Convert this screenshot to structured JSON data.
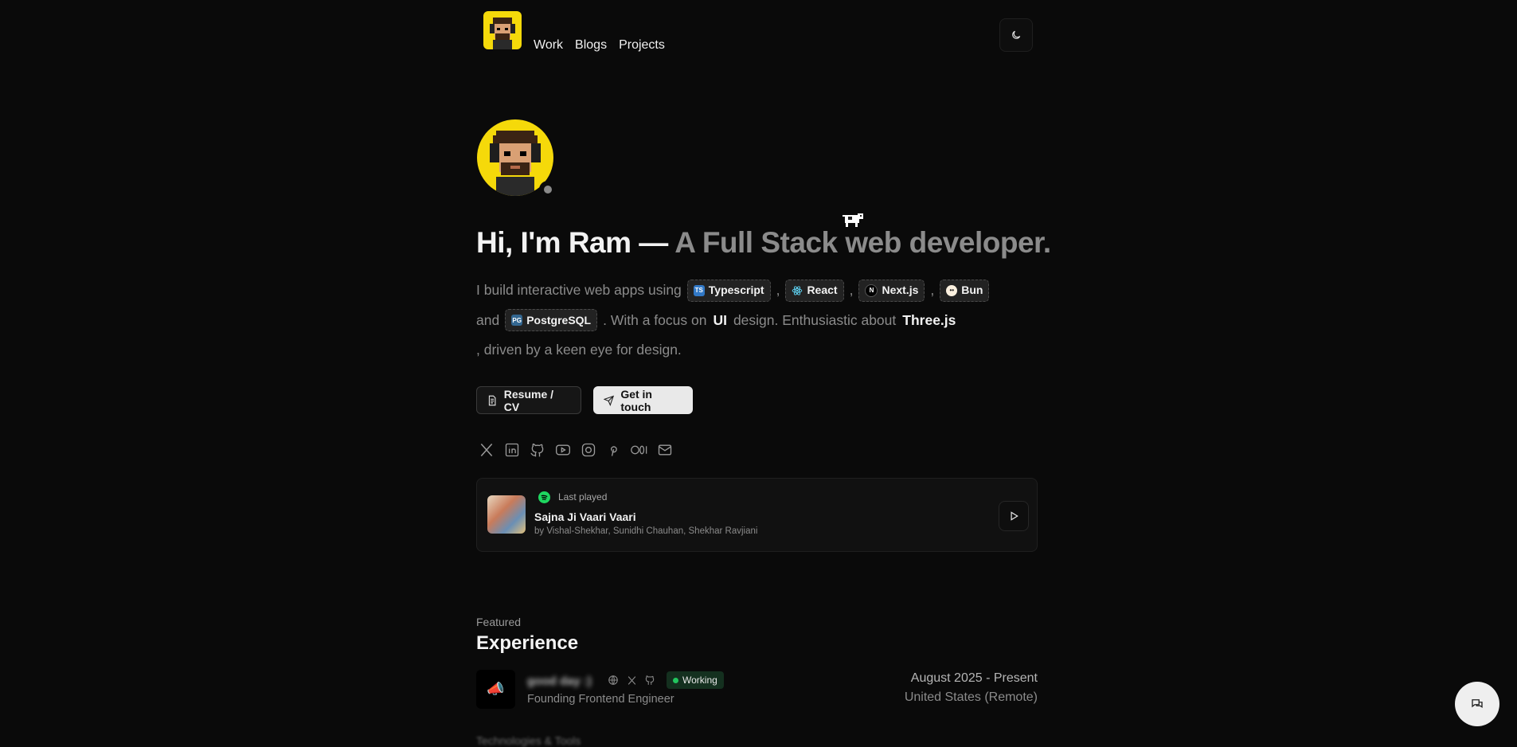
{
  "nav": {
    "links": [
      "Work",
      "Blogs",
      "Projects"
    ]
  },
  "hero": {
    "headline_prefix": "Hi, I'm Ram — ",
    "headline_role": "A Full Stack web developer.",
    "intro": {
      "lead": "I build interactive web apps using",
      "sep": ",",
      "and": "and",
      "focus_pre": ". With a focus on",
      "focus_strong": "UI",
      "focus_post": "design. Enthusiastic about",
      "enthusiastic": "Three.js",
      "tail": ", driven by a keen eye for design."
    },
    "skills": [
      {
        "label": "Typescript",
        "icon": "typescript-icon",
        "color": "#3178c6"
      },
      {
        "label": "React",
        "icon": "react-icon",
        "color": "#61dafb"
      },
      {
        "label": "Next.js",
        "icon": "nextjs-icon",
        "color": "#000000"
      },
      {
        "label": "Bun",
        "icon": "bun-icon",
        "color": "#fbf0df"
      },
      {
        "label": "PostgreSQL",
        "icon": "postgresql-icon",
        "color": "#336791"
      }
    ],
    "buttons": {
      "resume": "Resume / CV",
      "contact": "Get in touch"
    },
    "socials": [
      "x-icon",
      "linkedin-icon",
      "github-icon",
      "youtube-icon",
      "instagram-icon",
      "pinterest-icon",
      "medium-icon",
      "mail-icon"
    ]
  },
  "spotify": {
    "label": "Last played",
    "title": "Sajna Ji Vaari Vaari",
    "artist": "by Vishal-Shekhar, Sunidhi Chauhan, Shekhar Ravjiani",
    "accent": "#1ed760"
  },
  "experience": {
    "eyebrow": "Featured",
    "title": "Experience",
    "items": [
      {
        "company": "good day :)",
        "role": "Founding Frontend Engineer",
        "status": "Working",
        "dates": "August 2025 - Present",
        "location": "United States (Remote)"
      }
    ],
    "next_peek": "Technologies & Tools"
  },
  "colors": {
    "background": "#0a0a0a",
    "accent_yellow": "#f5d90a",
    "working_green": "#22c55e"
  }
}
